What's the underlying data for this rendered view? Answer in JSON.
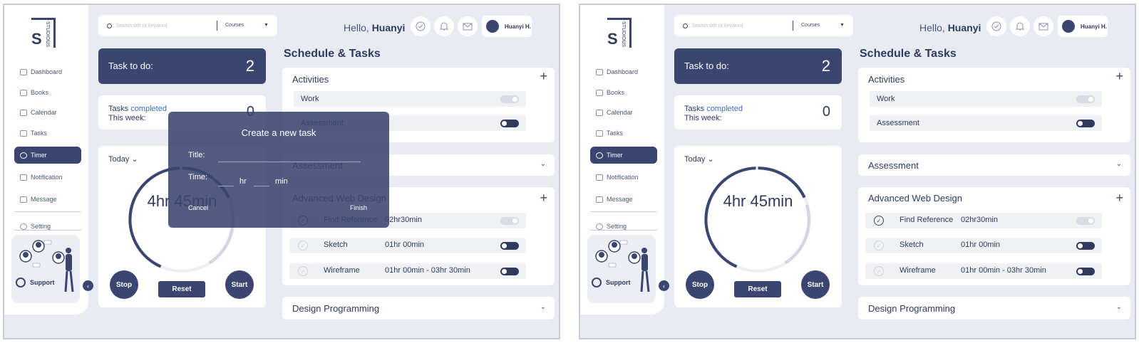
{
  "brand": {
    "letter": "S",
    "name": "STUDIOUS"
  },
  "nav": [
    "Dashboard",
    "Books",
    "Calendar",
    "Tasks",
    "Timer",
    "Notification",
    "Message"
  ],
  "setting": "Setting",
  "support": "Support",
  "collapse": "‹",
  "search": {
    "placeholder": "Search title or keyword",
    "select": "Courses",
    "caret": "▼"
  },
  "header": {
    "hello": "Hello,",
    "name": "Huanyi",
    "user": "Huanyi H.",
    "icons": [
      "check-icon",
      "bell-icon",
      "mail-icon"
    ]
  },
  "todo": {
    "label": "Task to do:",
    "count": "2"
  },
  "completed": {
    "pre": "Tasks",
    "hl": "completed",
    "line2": "This week:",
    "count": "0"
  },
  "timer": {
    "today": "Today",
    "chev": "⌄",
    "time": "4hr 45min",
    "stop": "Stop",
    "reset": "Reset",
    "start": "Start"
  },
  "schedule": {
    "title": "Schedule & Tasks"
  },
  "activities": {
    "title": "Activities",
    "plus": "+",
    "items": [
      "Work",
      "Assessment"
    ]
  },
  "assessment": {
    "title": "Assessment",
    "chev": "⌄"
  },
  "awd": {
    "title": "Advanced Web Design",
    "plus": "+",
    "tasks": [
      {
        "name": "Find Reference",
        "time": "02hr30min",
        "done": true
      },
      {
        "name": "Sketch",
        "time": "01hr 00min",
        "done": false
      },
      {
        "name": "Wireframe",
        "time": "01hr 00min - 03hr 30min",
        "done": false
      }
    ]
  },
  "design": {
    "title": "Design Programming",
    "chev": "⌄"
  },
  "modal": {
    "title": "Create a new task",
    "title_label": "Title:",
    "time_label": "Time:",
    "hr": "hr",
    "min": "min",
    "cancel": "Cancel",
    "finish": "Finish"
  },
  "colors": {
    "primary": "#3a4670",
    "bg": "#e9ebf3",
    "accent": "#3a6ec8"
  }
}
